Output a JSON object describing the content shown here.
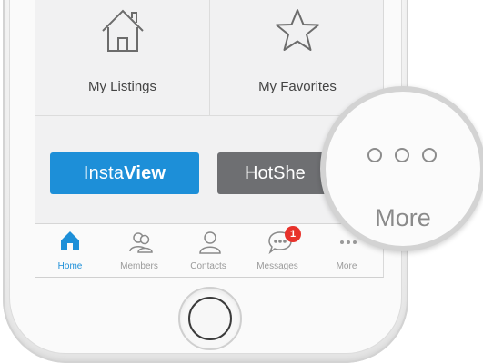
{
  "tiles": [
    {
      "label": "My Listings",
      "icon": "house-outline-icon"
    },
    {
      "label": "My Favorites",
      "icon": "star-outline-icon"
    }
  ],
  "buttons": {
    "instaview_prefix": "Insta",
    "instaview_bold": "View",
    "hotsheet_partial": "HotShe"
  },
  "tabbar": [
    {
      "label": "Home",
      "icon": "home-icon",
      "active": true
    },
    {
      "label": "Members",
      "icon": "members-icon",
      "active": false
    },
    {
      "label": "Contacts",
      "icon": "contact-icon",
      "active": false
    },
    {
      "label": "Messages",
      "icon": "messages-icon",
      "active": false,
      "badge": "1"
    },
    {
      "label": "More",
      "icon": "more-dots-icon",
      "active": false
    }
  ],
  "magnifier": {
    "label": "More"
  },
  "colors": {
    "accent": "#1d8fd8",
    "secondary_button": "#6e6f72",
    "badge": "#e8322b"
  }
}
